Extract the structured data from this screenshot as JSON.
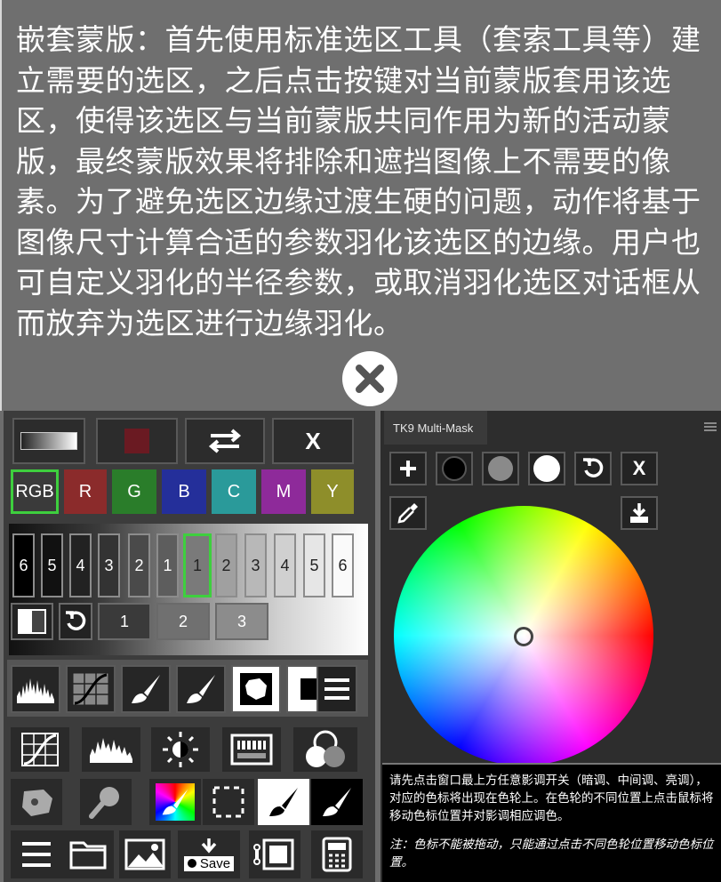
{
  "explanation": {
    "text": "嵌套蒙版：首先使用标准选区工具（套索工具等）建立需要的选区，之后点击按键对当前蒙版套用该选区，使得该选区与当前蒙版共同作用为新的活动蒙版，最终蒙版效果将排除和遮挡图像上不需要的像素。为了避免选区边缘过渡生硬的问题，动作将基于图像尺寸计算合适的参数羽化该选区的边缘。用户也可自定义羽化的半径参数，或取消羽化选区对话框从而放弃为选区进行边缘羽化。"
  },
  "close_icon": "close-x-icon",
  "left_panel": {
    "top_row": {
      "swap_icon": "swap-arrows-icon",
      "x_label": "X"
    },
    "channels": [
      "RGB",
      "R",
      "G",
      "B",
      "C",
      "M",
      "Y"
    ],
    "channel_colors": [
      "#3a3a3a",
      "#8b2b2b",
      "#2a7d2a",
      "#242f9a",
      "#2a9a9a",
      "#8e2a9a",
      "#8e8e2a"
    ],
    "selected_channel": "RGB",
    "zones": [
      "6",
      "5",
      "4",
      "3",
      "2",
      "1",
      "1",
      "2",
      "3",
      "4",
      "5",
      "6"
    ],
    "selected_zone_index": 6,
    "zone_buttons": [
      "1",
      "2",
      "3"
    ],
    "save_label": "Save"
  },
  "right_panel": {
    "title": "TK9 Multi-Mask",
    "x_label": "X",
    "help_text": "请先点击窗口最上方任意影调开关（暗调、中间调、亮调），对应的色标将出现在色轮上。在色轮的不同位置上点击鼠标将移动色标位置并对影调相应调色。",
    "help_note": "注：色标不能被拖动，只能通过点击不同色轮位置移动色标位置。"
  }
}
